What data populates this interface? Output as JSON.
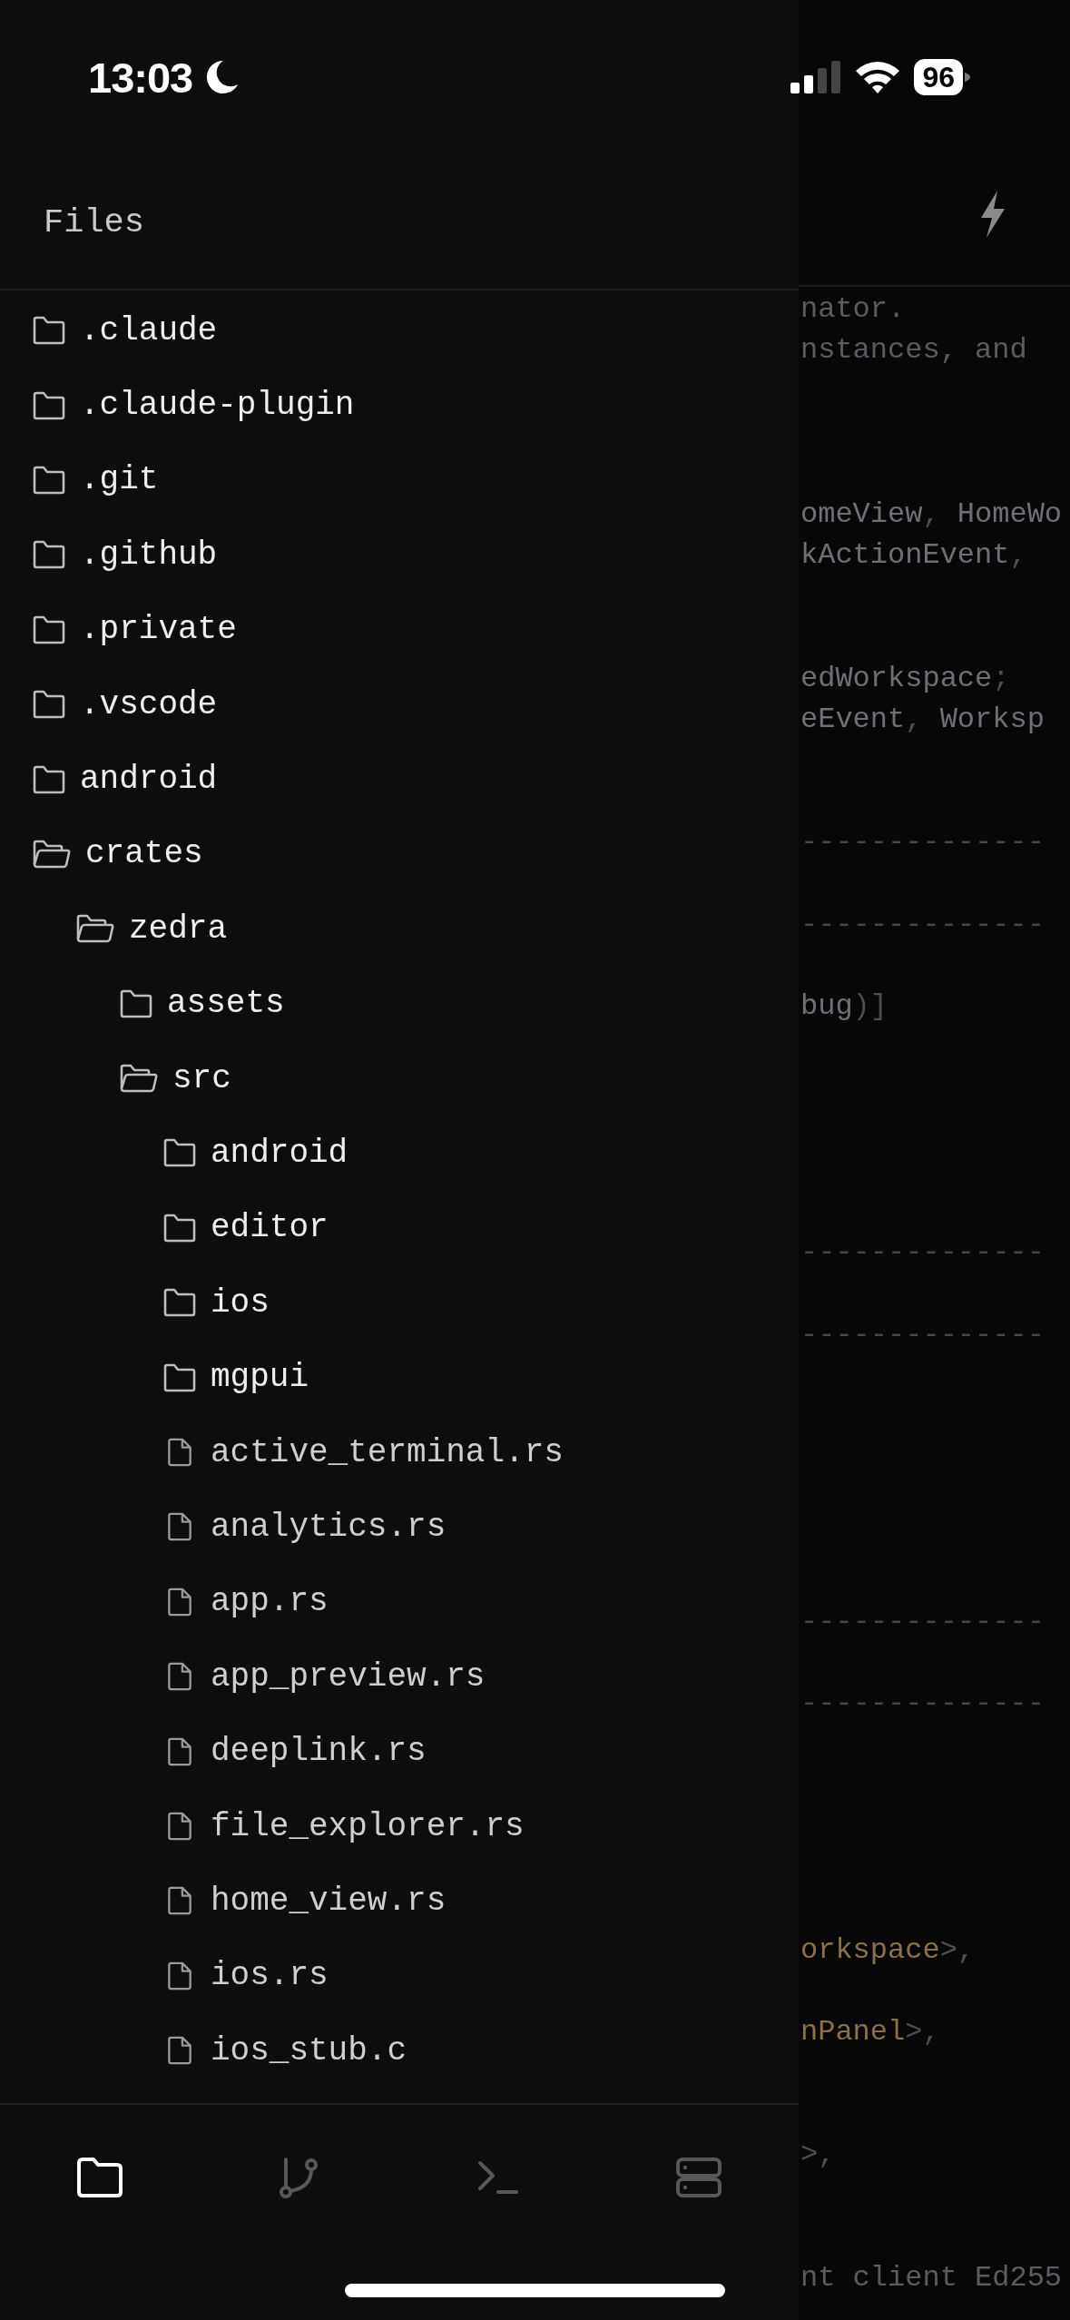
{
  "status_bar": {
    "time": "13:03",
    "battery": "96"
  },
  "files_panel": {
    "title": "Files",
    "tree": [
      {
        "name": ".claude",
        "kind": "folder",
        "expanded": false
      },
      {
        "name": ".claude-plugin",
        "kind": "folder",
        "expanded": false
      },
      {
        "name": ".git",
        "kind": "folder",
        "expanded": false
      },
      {
        "name": ".github",
        "kind": "folder",
        "expanded": false
      },
      {
        "name": ".private",
        "kind": "folder",
        "expanded": false
      },
      {
        "name": ".vscode",
        "kind": "folder",
        "expanded": false
      },
      {
        "name": "android",
        "kind": "folder",
        "expanded": false
      },
      {
        "name": "crates",
        "kind": "folder",
        "expanded": true,
        "children": [
          {
            "name": "zedra",
            "kind": "folder",
            "expanded": true,
            "children": [
              {
                "name": "assets",
                "kind": "folder",
                "expanded": false
              },
              {
                "name": "src",
                "kind": "folder",
                "expanded": true,
                "children": [
                  {
                    "name": "android",
                    "kind": "folder",
                    "expanded": false
                  },
                  {
                    "name": "editor",
                    "kind": "folder",
                    "expanded": false
                  },
                  {
                    "name": "ios",
                    "kind": "folder",
                    "expanded": false
                  },
                  {
                    "name": "mgpui",
                    "kind": "folder",
                    "expanded": false
                  },
                  {
                    "name": "active_terminal.rs",
                    "kind": "file"
                  },
                  {
                    "name": "analytics.rs",
                    "kind": "file"
                  },
                  {
                    "name": "app.rs",
                    "kind": "file"
                  },
                  {
                    "name": "app_preview.rs",
                    "kind": "file"
                  },
                  {
                    "name": "deeplink.rs",
                    "kind": "file"
                  },
                  {
                    "name": "file_explorer.rs",
                    "kind": "file"
                  },
                  {
                    "name": "home_view.rs",
                    "kind": "file"
                  },
                  {
                    "name": "ios.rs",
                    "kind": "file"
                  },
                  {
                    "name": "ios_stub.c",
                    "kind": "file"
                  }
                ]
              }
            ]
          }
        ]
      }
    ]
  },
  "editor": {
    "lines": [
      {
        "kind": "code",
        "segments": [
          {
            "text": "nator.",
            "kind": "comment"
          }
        ]
      },
      {
        "kind": "code",
        "segments": [
          {
            "text": "nstances, and",
            "kind": "comment"
          }
        ]
      },
      {
        "kind": "blank"
      },
      {
        "kind": "blank"
      },
      {
        "kind": "blank"
      },
      {
        "kind": "code",
        "segments": [
          {
            "text": "omeView",
            "kind": "plain"
          },
          {
            "text": ", ",
            "kind": "punct"
          },
          {
            "text": "HomeWo",
            "kind": "plain"
          }
        ]
      },
      {
        "kind": "code",
        "segments": [
          {
            "text": "kActionEvent",
            "kind": "plain"
          },
          {
            "text": ",",
            "kind": "punct"
          }
        ]
      },
      {
        "kind": "blank"
      },
      {
        "kind": "blank"
      },
      {
        "kind": "code",
        "segments": [
          {
            "text": "edWorkspace",
            "kind": "plain"
          },
          {
            "text": ";",
            "kind": "punct"
          }
        ]
      },
      {
        "kind": "code",
        "segments": [
          {
            "text": "eEvent",
            "kind": "plain"
          },
          {
            "text": ", ",
            "kind": "punct"
          },
          {
            "text": "Worksp",
            "kind": "plain"
          }
        ]
      },
      {
        "kind": "blank"
      },
      {
        "kind": "blank"
      },
      {
        "kind": "rule",
        "text": "--------------"
      },
      {
        "kind": "blank"
      },
      {
        "kind": "rule",
        "text": "--------------"
      },
      {
        "kind": "blank"
      },
      {
        "kind": "code",
        "segments": [
          {
            "text": "bug",
            "kind": "plain"
          },
          {
            "text": ")]",
            "kind": "punct"
          }
        ]
      },
      {
        "kind": "blank"
      },
      {
        "kind": "blank"
      },
      {
        "kind": "blank"
      },
      {
        "kind": "blank"
      },
      {
        "kind": "blank"
      },
      {
        "kind": "rule",
        "text": "--------------"
      },
      {
        "kind": "blank"
      },
      {
        "kind": "rule",
        "text": "--------------"
      },
      {
        "kind": "blank"
      },
      {
        "kind": "blank"
      },
      {
        "kind": "blank"
      },
      {
        "kind": "blank"
      },
      {
        "kind": "blank"
      },
      {
        "kind": "blank"
      },
      {
        "kind": "rule",
        "text": "--------------"
      },
      {
        "kind": "blank"
      },
      {
        "kind": "rule",
        "text": "--------------"
      },
      {
        "kind": "blank"
      },
      {
        "kind": "blank"
      },
      {
        "kind": "blank"
      },
      {
        "kind": "blank"
      },
      {
        "kind": "blank"
      },
      {
        "kind": "code",
        "segments": [
          {
            "text": "orkspace",
            "kind": "type"
          },
          {
            "text": ">,",
            "kind": "punct"
          }
        ]
      },
      {
        "kind": "blank"
      },
      {
        "kind": "code",
        "segments": [
          {
            "text": "nPanel",
            "kind": "type"
          },
          {
            "text": ">,",
            "kind": "punct"
          }
        ]
      },
      {
        "kind": "blank"
      },
      {
        "kind": "blank"
      },
      {
        "kind": "code",
        "segments": [
          {
            "text": ">,",
            "kind": "punct"
          }
        ]
      },
      {
        "kind": "blank"
      },
      {
        "kind": "blank"
      },
      {
        "kind": "code",
        "segments": [
          {
            "text": "nt client Ed255",
            "kind": "comment"
          }
        ]
      }
    ]
  },
  "tab_bar": [
    {
      "kind": "files",
      "selected": true
    },
    {
      "kind": "git",
      "selected": false
    },
    {
      "kind": "terminal",
      "selected": false
    },
    {
      "kind": "servers",
      "selected": false
    }
  ]
}
